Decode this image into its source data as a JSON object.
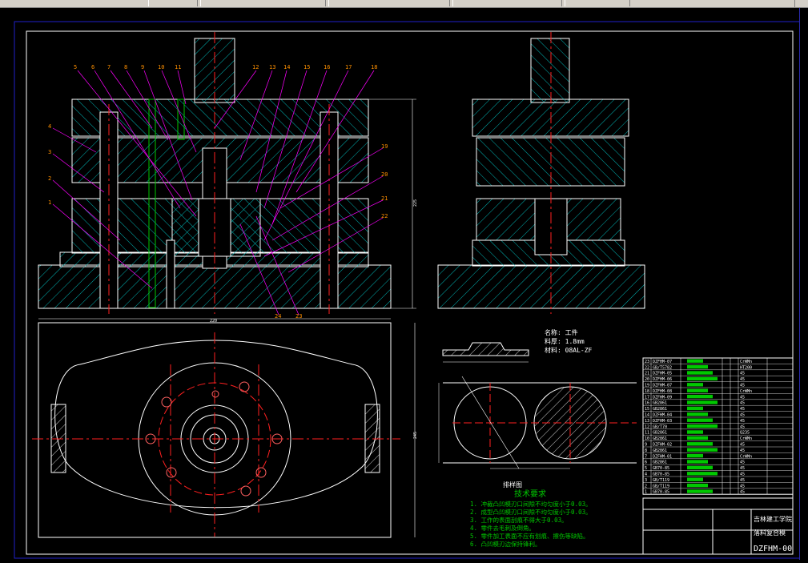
{
  "window": {
    "title": ""
  },
  "drawing": {
    "part_numbers_top": [
      "5",
      "6",
      "7",
      "8",
      "9",
      "10",
      "11",
      "12",
      "13",
      "14",
      "15",
      "16",
      "17",
      "18"
    ],
    "part_numbers_left": [
      "4",
      "3",
      "2",
      "1"
    ],
    "part_numbers_right": [
      "19",
      "20",
      "21",
      "22"
    ],
    "part_numbers_bottom": [
      "24",
      "23"
    ],
    "dim_top_width": "220",
    "dim_height": "225",
    "dim_plan_height": "245",
    "workpiece_title": "名称: 工件",
    "workpiece_thickness": "料厚: 1.8mm",
    "workpiece_material": "材料: 08AL-ZF",
    "strip_label": "排样图",
    "tech_title": "技术要求",
    "tech_items": [
      "1. 冲裁凸凹模刃口间隙不均匀度小于0.03。",
      "2. 成型凸凹模刃口间隙不均匀度小于0.03。",
      "3. 工作的表面刮痕不得大于0.03。",
      "4. 零件去毛刺及倒角。",
      "5. 零件加工表面不应有划痕、擦伤等缺陷。",
      "6. 凸凹模刃边保持锋利。"
    ],
    "title_block": {
      "school": "吉林建工学院",
      "drawing_name": "落料复合模",
      "drawing_no": "DZFHM-00"
    },
    "bom_rows": [
      {
        "no": "23",
        "code": "DZFHM-07",
        "mat": "CrWMn"
      },
      {
        "no": "22",
        "code": "GB/T5782",
        "mat": "HT200"
      },
      {
        "no": "21",
        "code": "DZFHM-05",
        "mat": "45"
      },
      {
        "no": "20",
        "code": "DZFHM-06",
        "mat": "45"
      },
      {
        "no": "19",
        "code": "DZFHM-07",
        "mat": "45"
      },
      {
        "no": "18",
        "code": "DZFHM-08",
        "mat": "CrWMn"
      },
      {
        "no": "17",
        "code": "DZFHM-09",
        "mat": "45"
      },
      {
        "no": "16",
        "code": "GB2861",
        "mat": "45"
      },
      {
        "no": "15",
        "code": "GB2861",
        "mat": "45"
      },
      {
        "no": "14",
        "code": "DZFHM-04",
        "mat": "45"
      },
      {
        "no": "13",
        "code": "DZFHM-03",
        "mat": "45"
      },
      {
        "no": "12",
        "code": "GB/T70",
        "mat": "45"
      },
      {
        "no": "11",
        "code": "GB2861",
        "mat": "Q235"
      },
      {
        "no": "10",
        "code": "GB2861",
        "mat": "CrWMn"
      },
      {
        "no": "9",
        "code": "DZFHM-02",
        "mat": "45"
      },
      {
        "no": "8",
        "code": "GB2861",
        "mat": "45"
      },
      {
        "no": "7",
        "code": "DZFHM-01",
        "mat": "CrWMn"
      },
      {
        "no": "6",
        "code": "GB2861",
        "mat": "45"
      },
      {
        "no": "5",
        "code": "GB70-85",
        "mat": "45"
      },
      {
        "no": "4",
        "code": "GB70-85",
        "mat": "45"
      },
      {
        "no": "3",
        "code": "GB/T119",
        "mat": "45"
      },
      {
        "no": "2",
        "code": "GB/T119",
        "mat": "45"
      },
      {
        "no": "1",
        "code": "GB70-85",
        "mat": "45"
      }
    ]
  },
  "colors": {
    "bg": "#000000",
    "line": "#ffffff",
    "hatch": "#00b4b4",
    "center": "#ff2020",
    "leader": "#ff00ff",
    "dim": "#00ff00",
    "frame": "#2020c8",
    "text": "#ffffff",
    "green": "#00c800"
  }
}
